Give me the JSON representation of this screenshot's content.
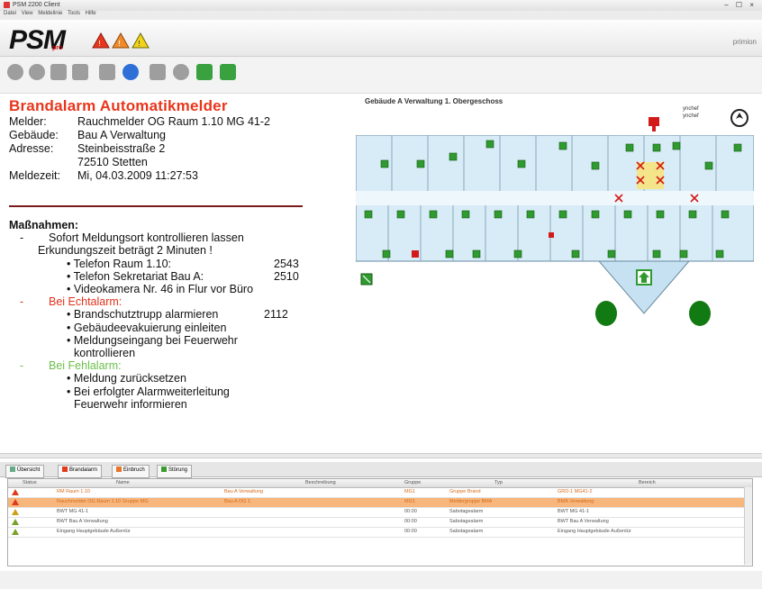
{
  "window": {
    "title": "PSM 2200 Client",
    "controls": "– ☐ ×"
  },
  "menu": [
    "Datei",
    "View",
    "Meldelinie",
    "Tools",
    "Hilfe"
  ],
  "logo": {
    "text": "PSM",
    "sub": "pro",
    "brand": "primion"
  },
  "toolbar": {
    "icons": [
      "circle-icon",
      "user-icon",
      "tag-icon",
      "tag-icon",
      "alarm-arrow-icon",
      "help-icon",
      "square-icon",
      "settings-icon",
      "export-icon",
      "back-icon"
    ]
  },
  "alarm": {
    "title": "Brandalarm Automatikmelder",
    "fields": [
      {
        "label": "Melder:",
        "value": "Rauchmelder OG Raum 1.10  MG 41-2"
      },
      {
        "label": "Gebäude:",
        "value": "Bau A Verwaltung"
      },
      {
        "label": "Adresse:",
        "value": "Steinbeisstraße 2"
      },
      {
        "label": "",
        "value": "72510 Stetten"
      },
      {
        "label": "Meldezeit:",
        "value": "Mi, 04.03.2009  11:27:53"
      }
    ]
  },
  "measures": {
    "heading": "Maßnahmen:",
    "intro1": "Sofort Meldungsort kontrollieren lassen",
    "intro2": "Erkundungszeit beträgt 2 Minuten !",
    "contacts": [
      {
        "label": "Telefon Raum 1.10:",
        "value": "2543"
      },
      {
        "label": "Telefon Sekretariat Bau A:",
        "value": "2510"
      },
      {
        "label": "Videokamera Nr. 46 in Flur vor Büro",
        "value": ""
      }
    ],
    "real_heading": "Bei Echtalarm:",
    "real": [
      {
        "label": "Brandschutztrupp alarmieren",
        "value": "2112"
      },
      {
        "label": "Gebäudeevakuierung einleiten",
        "value": ""
      },
      {
        "label": "Meldungseingang bei Feuerwehr",
        "value": ""
      },
      {
        "label": "kontrollieren",
        "value": ""
      }
    ],
    "false_heading": "Bei Fehlalarm:",
    "false": [
      "Meldung zurücksetzen",
      "Bei erfolgter Alarmweiterleitung",
      "Feuerwehr informieren"
    ]
  },
  "floorplan": {
    "title": "Gebäude A Verwaltung 1. Obergeschoss",
    "legend1": "ynchef",
    "legend2": "ynchef"
  },
  "tabs": [
    {
      "label": "Übersicht",
      "color": "#6a8"
    },
    {
      "label": "Brandalarm",
      "color": "#e03c1c"
    },
    {
      "label": "Einbruch",
      "color": "#e7742a"
    },
    {
      "label": "Störung",
      "color": "#3a9c2c"
    }
  ],
  "table": {
    "headers": [
      "Status",
      "Name",
      "Beschreibung",
      "Gruppe",
      "Typ",
      "Bereich"
    ],
    "rows": [
      {
        "status": "#e03c1c",
        "name": "RM Raum 1.10",
        "desc": "Bau A Verwaltung",
        "group": "MG1",
        "type": "Gruppe Brand",
        "area": "GRD-1 MG41-2",
        "style": "orange"
      },
      {
        "status": "#e03c1c",
        "name": "Rauchmelder OG Raum 1.10 Gruppe MG",
        "desc": "Bau A OG 1",
        "group": "MG1",
        "type": "Meldergruppe BMA",
        "area": "BMA Verwaltung",
        "style": "sel"
      },
      {
        "status": "#c9a21a",
        "name": "BWT MG 41-1",
        "desc": "",
        "group": "00:00",
        "type": "Sabotagealarm",
        "area": "BWT MG 41-1",
        "style": ""
      },
      {
        "status": "#7aa22a",
        "name": "BWT Bau A Verwaltung",
        "desc": "",
        "group": "00:00",
        "type": "Sabotagealarm",
        "area": "BWT Bau A Verwaltung",
        "style": ""
      },
      {
        "status": "#7aa22a",
        "name": "Eingang Hauptgebäude Außentür",
        "desc": "",
        "group": "00:00",
        "type": "Sabotagealarm",
        "area": "Eingang Hauptgebäude Außentür",
        "style": ""
      }
    ]
  }
}
